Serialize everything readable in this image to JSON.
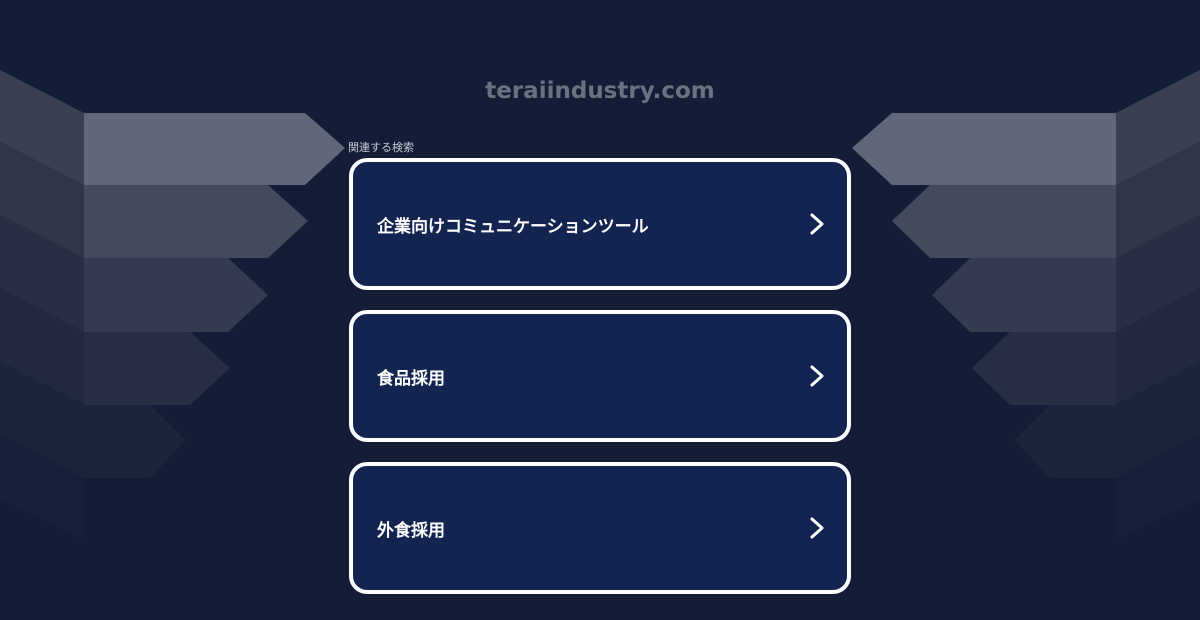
{
  "page": {
    "background_color": "#131d38",
    "card_color": "#12244f",
    "card_border_color": "#ffffff",
    "title_color": "#6c7180"
  },
  "header": {
    "domain": "teraiindustry.com"
  },
  "related_searches": {
    "label": "関連する検索",
    "items": [
      {
        "label": "企業向けコミュニケーションツール",
        "icon": "chevron-right-icon"
      },
      {
        "label": "食品採用",
        "icon": "chevron-right-icon"
      },
      {
        "label": "外食採用",
        "icon": "chevron-right-icon"
      }
    ]
  }
}
